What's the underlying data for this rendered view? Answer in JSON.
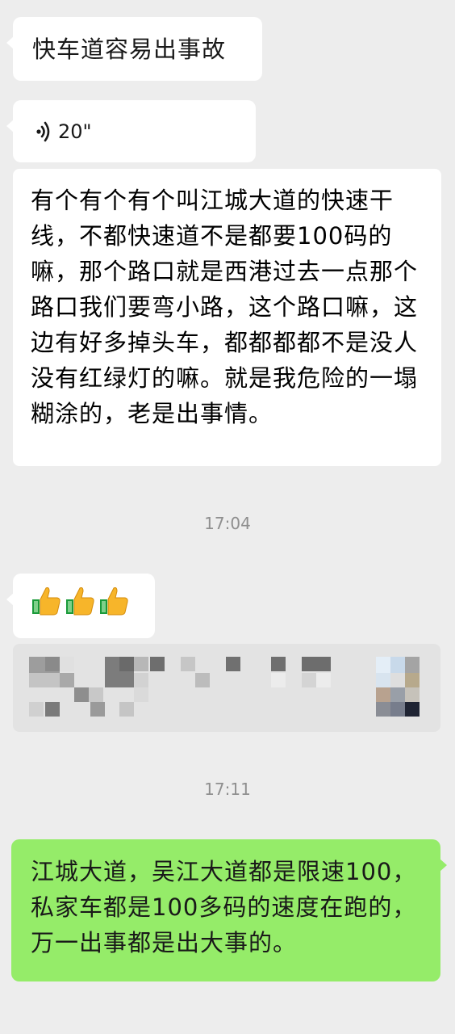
{
  "chat": {
    "messages": [
      {
        "type": "text",
        "side": "left",
        "text": "快车道容易出事故"
      },
      {
        "type": "voice",
        "side": "left",
        "duration": "20\""
      },
      {
        "type": "transcript",
        "text": "有个有个有个叫江城大道的快速干线，不都快速道不是都要100码的嘛，那个路口就是西港过去一点那个路口我们要弯小路，这个路口嘛，这边有好多掉头车，都都都都不是没人没有红绿灯的嘛。就是我危险的一塌糊涂的，老是出事情。"
      },
      {
        "type": "timestamp",
        "text": "17:04"
      },
      {
        "type": "emoji",
        "side": "left",
        "icons": [
          "thumbs-up-icon",
          "thumbs-up-icon",
          "thumbs-up-icon"
        ]
      },
      {
        "type": "link-card",
        "side": "left",
        "content": "pixelated"
      },
      {
        "type": "timestamp",
        "text": "17:11"
      },
      {
        "type": "text",
        "side": "right",
        "text": "江城大道，吴江大道都是限速100，私家车都是100多码的速度在跑的，万一出事都是出大事的。"
      }
    ]
  },
  "colors": {
    "background": "#ededed",
    "bubble_left": "#ffffff",
    "bubble_right": "#95ec69",
    "timestamp": "#8f8f8f"
  }
}
